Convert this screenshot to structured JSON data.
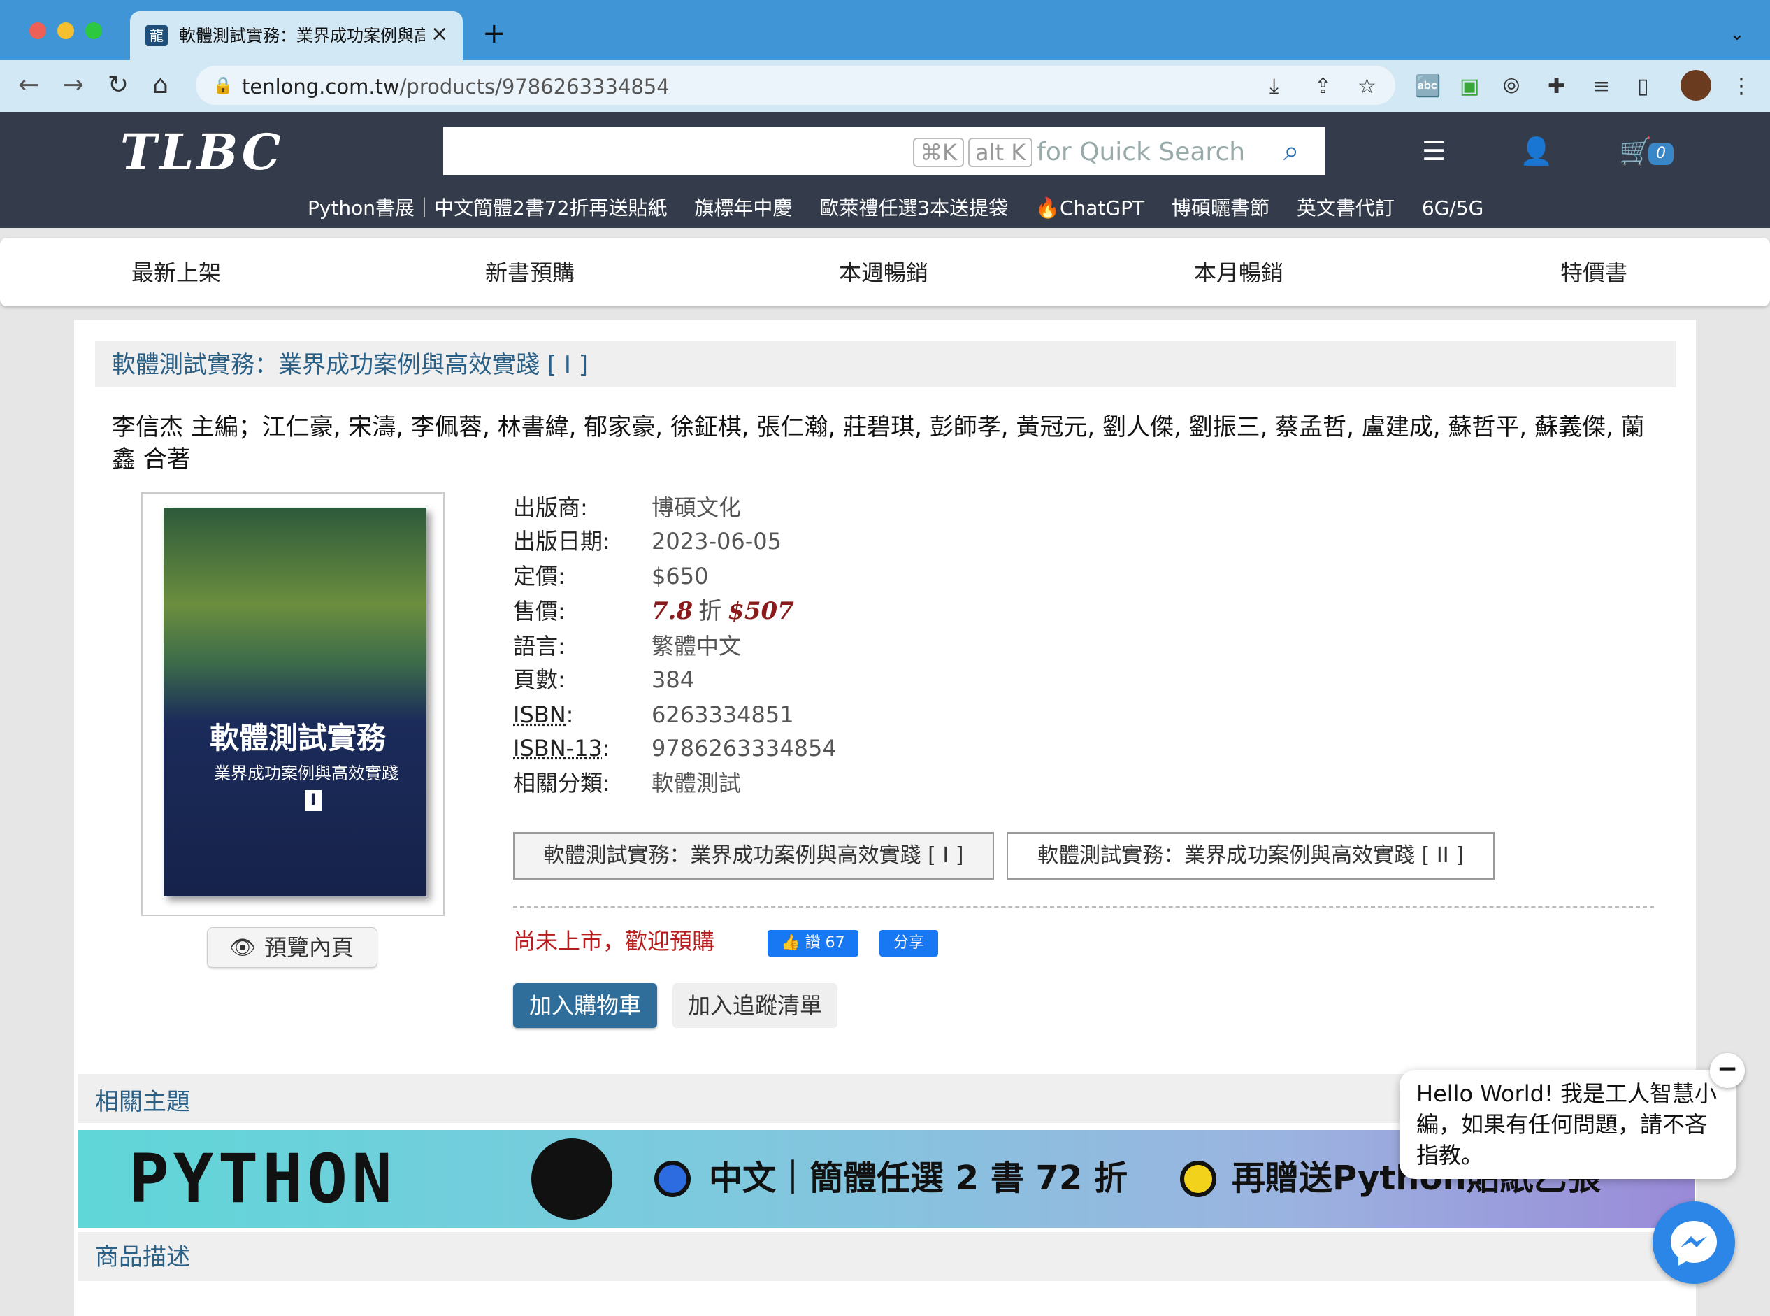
{
  "browser": {
    "tab_title": "軟體測試實務：業界成功案例與高效實踐",
    "tab_close": "×",
    "new_tab": "+",
    "url_host": "tenlong.com.tw",
    "url_path": "/products/9786263334854",
    "colors": {
      "tabbar": "#3f95d6",
      "toolbar": "#d3e8f5"
    }
  },
  "site": {
    "logo": "TLBC",
    "search": {
      "placeholder": "",
      "hint_key1": "⌘K",
      "hint_key2": "alt K",
      "hint_text": "for Quick Search"
    },
    "cart_count": "0",
    "promo_links": [
      "Python書展｜中文簡體2書72折再送貼紙",
      "旗標年中慶",
      "歐萊禮任選3本送提袋",
      "🔥ChatGPT",
      "博碩曬書節",
      "英文書代訂",
      "6G/5G"
    ],
    "categories": [
      "最新上架",
      "新書預購",
      "本週暢銷",
      "本月暢銷",
      "特價書"
    ]
  },
  "product": {
    "title": "軟體測試實務：業界成功案例與高效實踐 [ I ]",
    "authors": "李信杰 主編；江仁豪, 宋濤, 李佩蓉, 林書緯, 郁家豪, 徐鉦棋, 張仁瀚, 莊碧琪, 彭師孝, 黃冠元, 劉人傑, 劉振三, 蔡孟哲, 盧建成, 蘇哲平, 蘇義傑, 蘭鑫 合著",
    "cover": {
      "title": "軟體測試實務",
      "subtitle": "業界成功案例與高效實踐",
      "volume": "I"
    },
    "preview_label": "預覽內頁",
    "info": {
      "publisher_label": "出版商:",
      "publisher": "博碩文化",
      "date_label": "出版日期:",
      "date": "2023-06-05",
      "list_price_label": "定價:",
      "list_price": "$650",
      "sale_price_label": "售價:",
      "discount": "7.8",
      "discount_unit": "折",
      "sale_price": "$507",
      "language_label": "語言:",
      "language": "繁體中文",
      "pages_label": "頁數:",
      "pages": "384",
      "isbn_label": "ISBN",
      "isbn": "6263334851",
      "isbn13_label": "ISBN-13",
      "isbn13": "9786263334854",
      "category_label": "相關分類:",
      "category": "軟體測試"
    },
    "volumes": [
      "軟體測試實務：業界成功案例與高效實踐 [ I ]",
      "軟體測試實務：業界成功案例與高效實踐 [ II ]"
    ],
    "status": "尚未上市，歡迎預購",
    "fb_like": "讚 67",
    "fb_share": "分享",
    "add_to_cart": "加入購物車",
    "add_to_wishlist": "加入追蹤清單"
  },
  "sections": {
    "related": "相關主題",
    "description": "商品描述"
  },
  "banner": {
    "logo_text": "PYTHON",
    "text1": "中文｜簡體任選 2 書 72 折",
    "text2": "再贈送Python貼紙乙張"
  },
  "chat": {
    "message": "Hello World! 我是工人智慧小編，如果有任何問題，請不吝指教。",
    "minimize": "−"
  }
}
